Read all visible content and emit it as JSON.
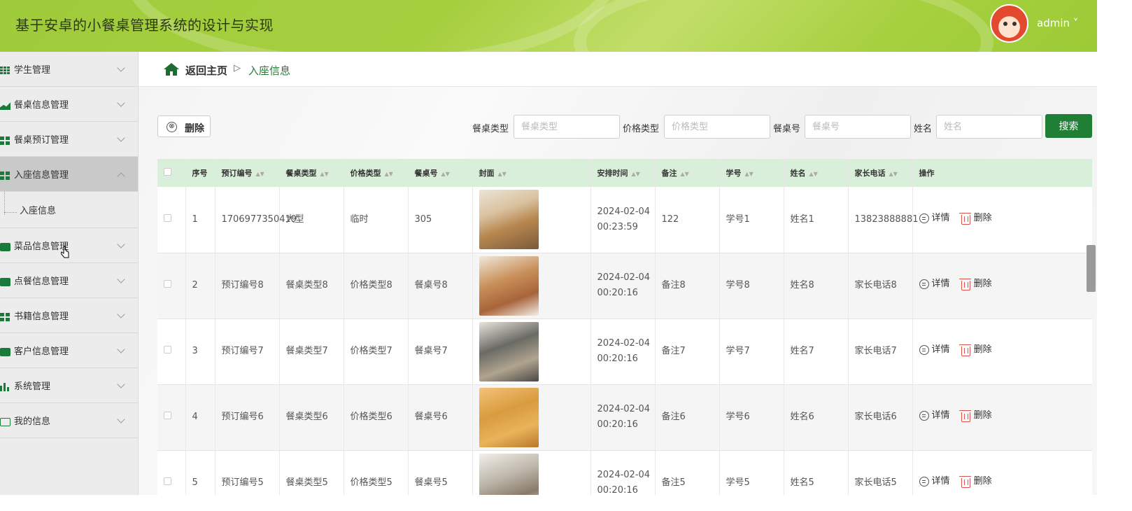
{
  "header": {
    "title": "基于安卓的小餐桌管理系统的设计与实现",
    "user": "admin ˅"
  },
  "sidebar": {
    "items": [
      {
        "label": "学生管理",
        "icon": "grid-icon"
      },
      {
        "label": "餐桌信息管理",
        "icon": "trend-icon"
      },
      {
        "label": "餐桌预订管理",
        "icon": "four-squares-icon"
      },
      {
        "label": "入座信息管理",
        "icon": "four-squares-icon",
        "active": true,
        "sub": [
          "入座信息"
        ]
      },
      {
        "label": "菜品信息管理",
        "icon": "briefcase-icon"
      },
      {
        "label": "点餐信息管理",
        "icon": "pin-icon"
      },
      {
        "label": "书籍信息管理",
        "icon": "four-squares-icon"
      },
      {
        "label": "客户信息管理",
        "icon": "clipboard-icon"
      },
      {
        "label": "系统管理",
        "icon": "bar-chart-icon"
      },
      {
        "label": "我的信息",
        "icon": "card-icon"
      }
    ]
  },
  "breadcrumb": {
    "home": "返回主页",
    "sep": "▷",
    "current": "入座信息"
  },
  "toolbar": {
    "delete_label": "删除",
    "delete_icon": "⊗",
    "search_label": "搜索"
  },
  "filters": [
    {
      "label": "餐桌类型",
      "placeholder": "餐桌类型"
    },
    {
      "label": "价格类型",
      "placeholder": "价格类型"
    },
    {
      "label": "餐桌号",
      "placeholder": "餐桌号"
    },
    {
      "label": "姓名",
      "placeholder": "姓名"
    }
  ],
  "table": {
    "headers": [
      "序号",
      "预订编号",
      "餐桌类型",
      "价格类型",
      "餐桌号",
      "封面",
      "安排时间",
      "备注",
      "学号",
      "姓名",
      "家长电话",
      "操作"
    ],
    "detail_label": "详情",
    "delete_label": "删除",
    "rows": [
      {
        "idx": "1",
        "order": "1706977350419",
        "type": "大型",
        "price": "临时",
        "table": "305",
        "time": "2024-02-04 00:23:59",
        "note": "122",
        "sid": "学号1",
        "name": "姓名1",
        "phone": "13823888881"
      },
      {
        "idx": "2",
        "order": "预订编号8",
        "type": "餐桌类型8",
        "price": "价格类型8",
        "table": "餐桌号8",
        "time": "2024-02-04 00:20:16",
        "note": "备注8",
        "sid": "学号8",
        "name": "姓名8",
        "phone": "家长电话8"
      },
      {
        "idx": "3",
        "order": "预订编号7",
        "type": "餐桌类型7",
        "price": "价格类型7",
        "table": "餐桌号7",
        "time": "2024-02-04 00:20:16",
        "note": "备注7",
        "sid": "学号7",
        "name": "姓名7",
        "phone": "家长电话7"
      },
      {
        "idx": "4",
        "order": "预订编号6",
        "type": "餐桌类型6",
        "price": "价格类型6",
        "table": "餐桌号6",
        "time": "2024-02-04 00:20:16",
        "note": "备注6",
        "sid": "学号6",
        "name": "姓名6",
        "phone": "家长电话6"
      },
      {
        "idx": "5",
        "order": "预订编号5",
        "type": "餐桌类型5",
        "price": "价格类型5",
        "table": "餐桌号5",
        "time": "2024-02-04 00:20:16",
        "note": "备注5",
        "sid": "学号5",
        "name": "姓名5",
        "phone": "家长电话5"
      }
    ]
  },
  "colors": {
    "accent": "#1f8035",
    "header_bg": "#a3ce3c",
    "table_head_bg": "#d9efd9"
  }
}
